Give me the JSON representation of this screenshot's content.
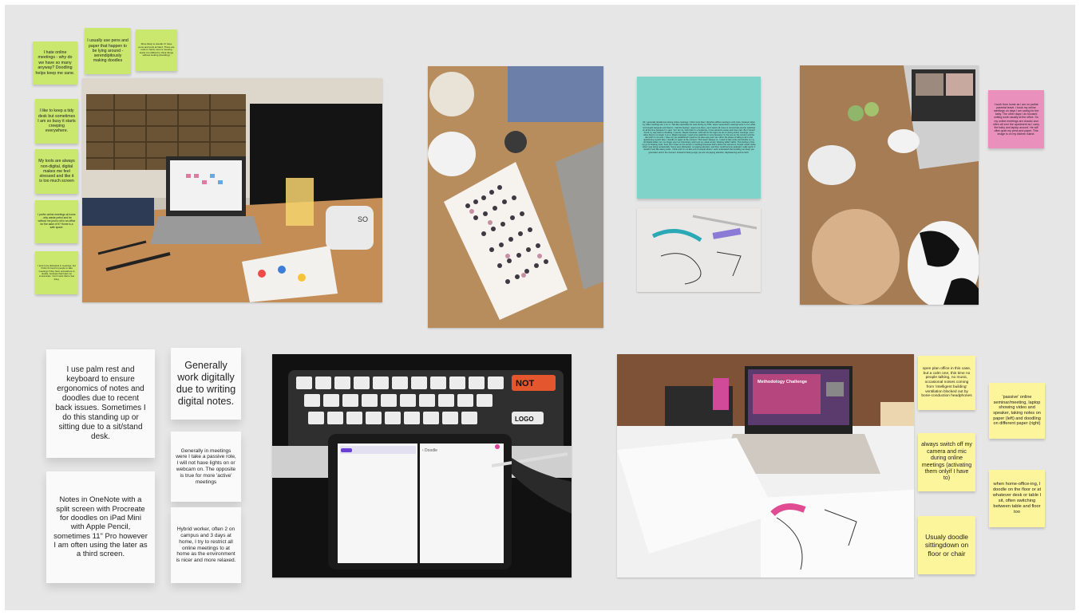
{
  "board": {
    "background_color": "#e6e6e6",
    "colors": {
      "lime_note": "#c9e86d",
      "yellow_note": "#fdf59c",
      "white_note": "#fafafa",
      "teal_note": "#7fd3c8",
      "pink_note": "#ea90bd"
    }
  },
  "notes": {
    "hate_online": "I hate online meetings - why do we have so many anyway? Doodling helps keep me sane.",
    "pens_paper": "I usually use pens and paper that happen to be lying around - serendipitously making doodles",
    "more_likely": "More likely to doodle if I have pens and tools at hand. There are tools in hand, even a meeting starts it is difficult to think things without looking (doodling).",
    "tidy_desk": "I like to keep a tidy desk but sometimes I am so busy it starts creeping everywhere.",
    "non_digital": "My tools are always non-digital, digital makes me feel stressed and like it is too much screen",
    "prefer_online": "I prefer online meetings at home - why waste petrol and be without me just to sit in an office for the sake of it? Home is a safe space.",
    "small_note": "I tend to be distracted in meetings, but I think it's best for people to take meetings if they have somewhere to doodle, because that helps me concentrate. I don't want that to feel tiring.",
    "teal_long": "All, I generally doodle less during online meetings. I think more than I did when offline meeting is a bit more, however when my video meetings are 1-on-1, I feel like especially the case during my PhD, where supervisors meetings were 1-on-1 while not brought hangouts and Teams. I had the feeling I need to be there, can't switch off, have to concentrate and be switched on all the time because I'm seen. So I do not. Now that I'm a freelancer, it has started to cause and inner pain. But I haven't found my way back to doodling. It seems. Maybe because I will look for the signs we do on during online meetings, even when they're no longer 1-on-1. Maybe because I need to be watchful or more because I'm the one on the monitor and the tab and I'm not sure. I have not yet established myself so it's also easy and I am still in the phase of taking it all in and questioning myself. Also, I doodle on paper at the moment. That wasn't always so. I used to take notes and doodle on my old digital tablet, but I no longer use it as intensively, and it got my usual screen 'drawing tablet' habits. This feeling is how my go to drawing tools. Sure, But I draw on the screen in meetings because that's where the camera is. People would notice what I was doing occasionally. Some were distracted, not paying attention, and then could become awkward, really quick. It wouldn't look like taking notes. I think and I'm not like a lot of people where I work understand that doodling can keep you grounded, and in the moment. Instead of being a sign you are not paying attention, daydreaming and so forth.",
    "pink_note": "I work from home as I am on partial parental leave. I book my online meetings on days I am caring for the baby. The other days I do focused writing work usually at the office. So my online meetings are chaotic and often all over the apartment as I carry the baby and laptop around. He will often grab my pens and paper. This image is on my kitchen island.",
    "palm_rest": "I use palm rest and keyboard to ensure ergonomics of notes and doodles due to recent back issues. Sometimes I do this standing up or sitting due to a sit/stand desk.",
    "generally_work": "Generally work digitally due to writing digital notes.",
    "onenote": "Notes in OneNote with a split screen with Procreate for doodles on iPad Mini with Apple Pencil, sometimes 11\" Pro however I am often using the later as a third screen.",
    "passive_role": "Generally in meetings were I take a passive role, I will not have lights on or webcam on. The opposite is true for more 'active' meetings",
    "hybrid": "Hybrid worker, often 2 on campus and 3 days at home, I try to restrict all online meetings to at home as the environment is nicer and more relaxed.",
    "open_plan": "open plan office in this case, but a calm one, this time no people talking, no music, occasional noises coming from 'intelligent building' ventilation blocked out by bone-conduction headphones",
    "switch_off": "always switch off my camera and mic during online meetings (activating them onlyif I have to)",
    "usualy_doodle": "Usualy doodle sittingdown on floor or chair",
    "passive_seminar": "'passive' online seminar/meeting, laptop showing video and speaker, taking notes on paper (left) and doodling on different paper (right)",
    "home_office": "when home-office-ing, I  doodle on the floor or at whatever desk or table I sit, often switching between table and floor too"
  },
  "photos": {
    "desk_setup": {
      "icon": "desk-photo",
      "screen_text": "SO"
    },
    "watercolor_dots": {
      "icon": "watercolor-photo"
    },
    "sketch_pens": {
      "icon": "sketch-photo"
    },
    "baby_kitchen": {
      "icon": "kitchen-photo"
    },
    "ipad_keyboard": {
      "icon": "keyboard-photo",
      "key_label_1": "NOT",
      "key_label_2": "LOGO",
      "app_back": "‹ Doodle"
    },
    "seminar_laptop": {
      "icon": "seminar-photo",
      "slide_title": "Methodology Challenge"
    }
  }
}
